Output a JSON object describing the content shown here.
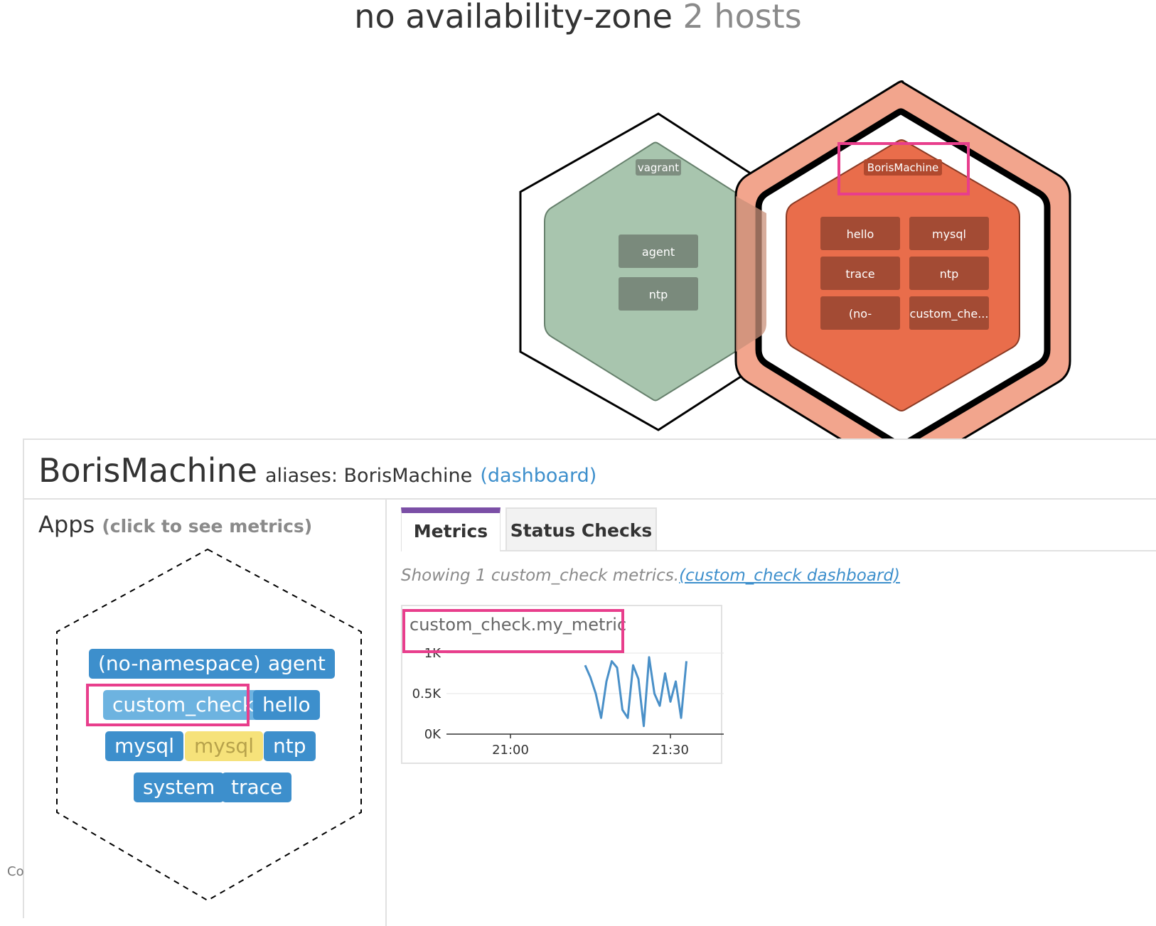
{
  "zone": {
    "title": "no availability-zone",
    "host_count": "2 hosts"
  },
  "hosts": [
    {
      "name": "vagrant",
      "apps": [
        "agent",
        "ntp"
      ],
      "color": "#a8c5ae"
    },
    {
      "name": "BorisMachine",
      "apps": [
        "hello",
        "mysql",
        "trace",
        "ntp",
        "(no-",
        "custom_che..."
      ],
      "color": "#e96d4b"
    }
  ],
  "panel": {
    "host_name": "BorisMachine",
    "aliases_label": "aliases: BorisMachine",
    "dashboard_link": "(dashboard)",
    "apps_title": "Apps",
    "apps_hint": "(click to see metrics)",
    "apps": [
      "(no-namespace)",
      "agent",
      "custom_check",
      "hello",
      "mysql",
      "mysql",
      "ntp",
      "system",
      "trace"
    ],
    "tabs": [
      "Metrics",
      "Status Checks"
    ],
    "showing_text": "Showing 1 custom_check metrics.",
    "showing_link": "(custom_check dashboard)",
    "metric": {
      "title": "custom_check.my_metric",
      "y_ticks": [
        "1K",
        "0.5K",
        "0K"
      ],
      "x_ticks": [
        "21:00",
        "21:30"
      ]
    }
  },
  "corner_text": "Co",
  "chart_data": {
    "type": "line",
    "title": "custom_check.my_metric",
    "xlabel": "",
    "ylabel": "",
    "ylim": [
      0,
      1000
    ],
    "xlim": [
      "20:48",
      "21:40"
    ],
    "x_ticks": [
      "21:00",
      "21:30"
    ],
    "y_ticks": [
      "0K",
      "0.5K",
      "1K"
    ],
    "grid": true,
    "series": [
      {
        "color": "#4a90c8",
        "x": [
          "21:14",
          "21:15",
          "21:16",
          "21:17",
          "21:18",
          "21:19",
          "21:20",
          "21:21",
          "21:22",
          "21:23",
          "21:24",
          "21:25",
          "21:26",
          "21:27",
          "21:28",
          "21:29",
          "21:30",
          "21:31",
          "21:32",
          "21:33"
        ],
        "y": [
          850,
          700,
          500,
          200,
          650,
          900,
          820,
          300,
          200,
          850,
          680,
          100,
          950,
          500,
          350,
          750,
          400,
          650,
          200,
          900
        ]
      }
    ]
  }
}
